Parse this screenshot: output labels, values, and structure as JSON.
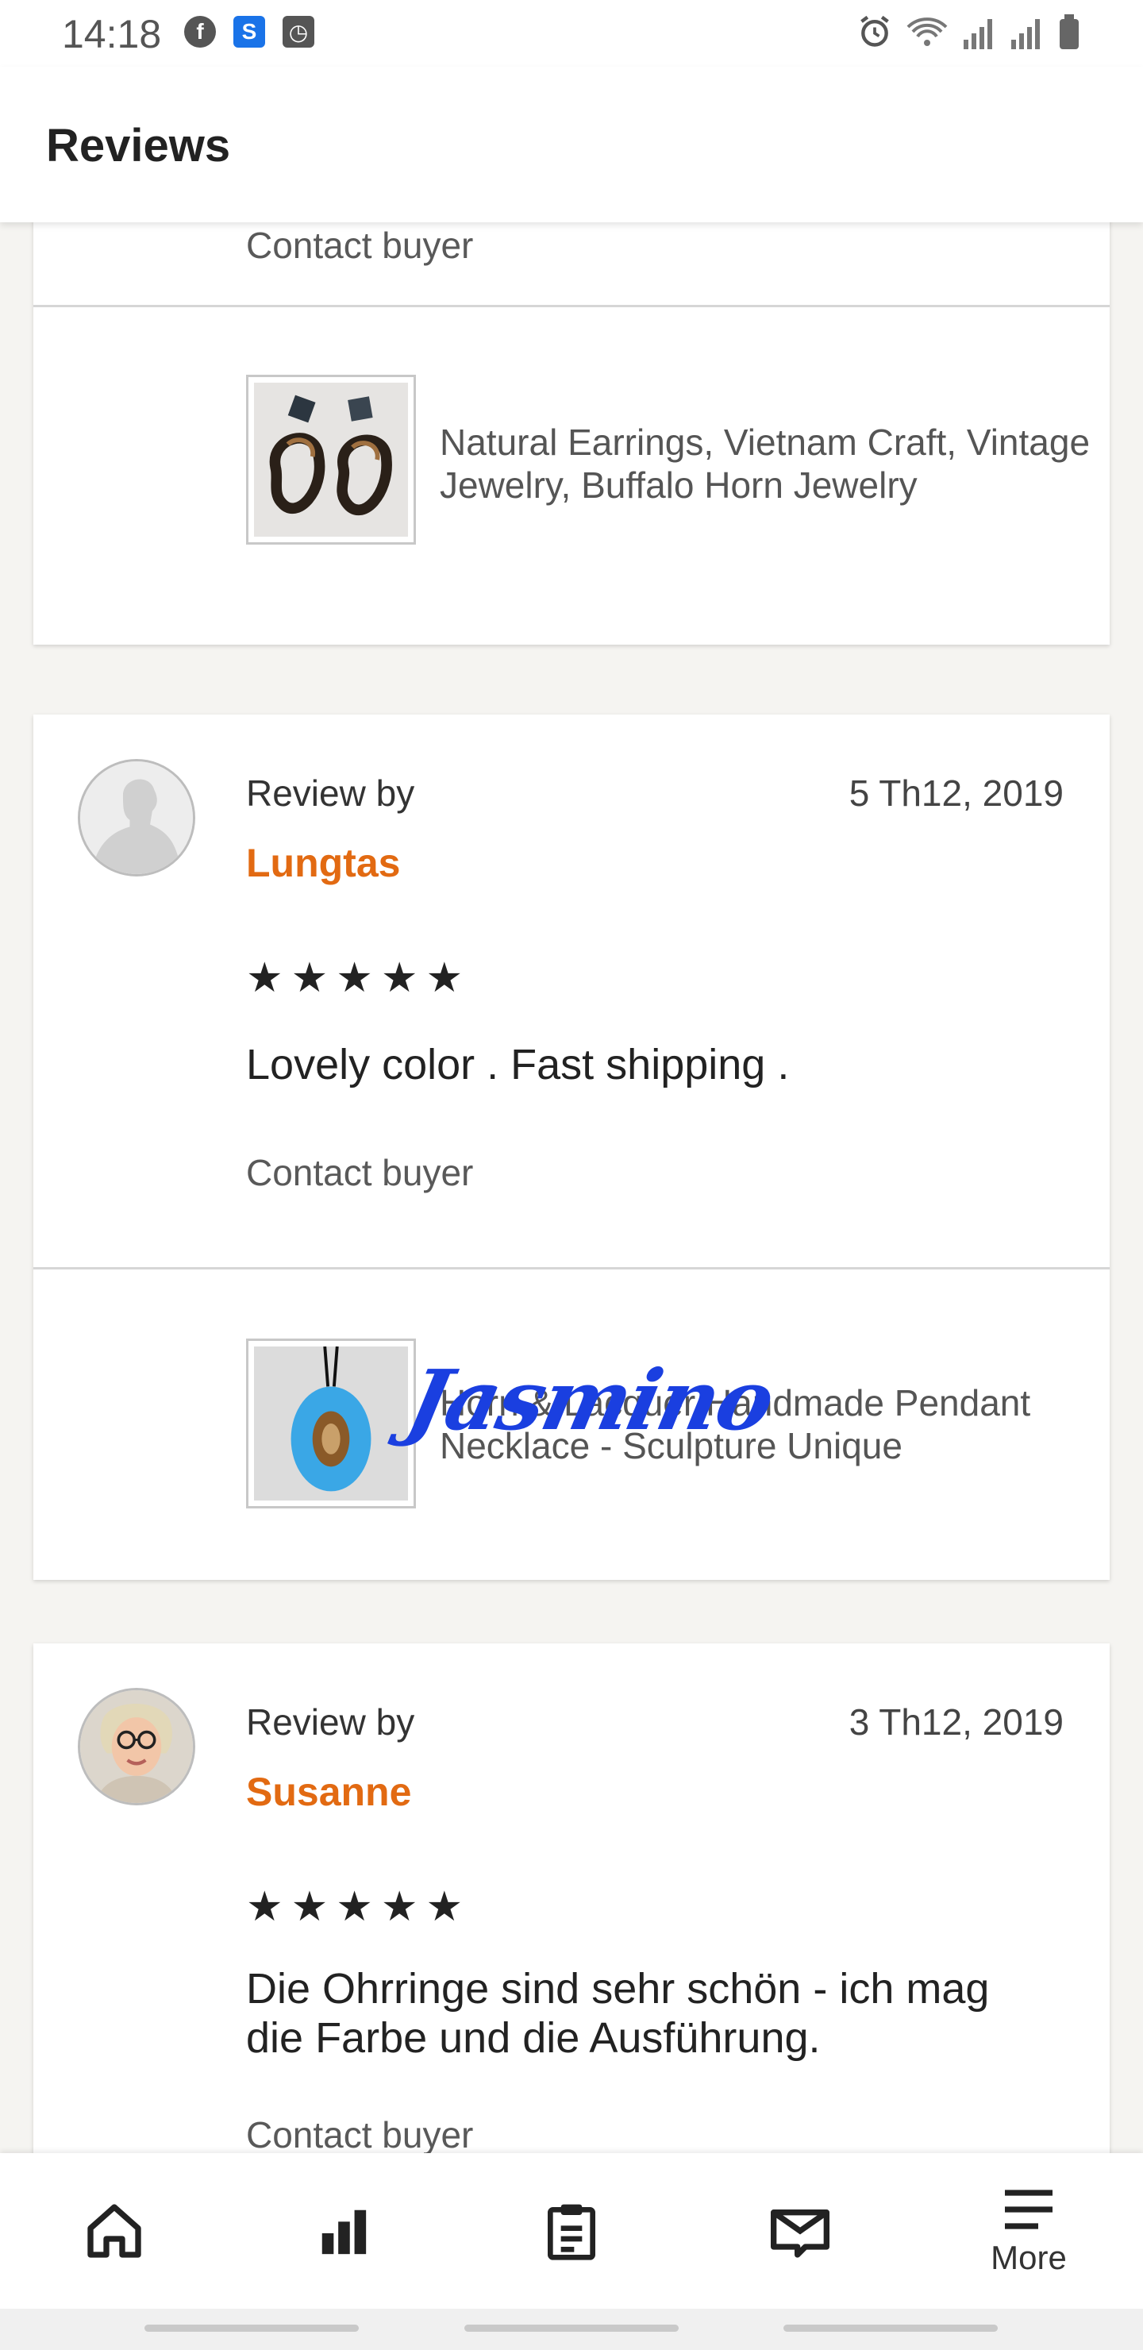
{
  "status_bar": {
    "time": "14:18",
    "left_icons": [
      "facebook-icon",
      "s-app-icon",
      "calendar-app-icon"
    ],
    "right_icons": [
      "alarm-icon",
      "wifi-icon",
      "signal-icon",
      "signal-icon",
      "battery-icon"
    ]
  },
  "header": {
    "title": "Reviews"
  },
  "reviews_top": {
    "contact_label": "Contact buyer"
  },
  "listing_1": {
    "title": "Natural Earrings, Vietnam Craft, Vintage Jewelry, Buffalo Horn Jewelry"
  },
  "review_1": {
    "review_by": "Review by",
    "reviewer": "Lungtas",
    "date": "5 Th12, 2019",
    "stars": "★★★★★",
    "rating": 5,
    "text": "Lovely color . Fast shipping .",
    "contact_label": "Contact buyer"
  },
  "watermark": "Jasmino",
  "listing_2": {
    "title": "Horn & Lacquer Handmade Pendant Necklace - Sculpture Unique"
  },
  "review_2": {
    "review_by": "Review by",
    "reviewer": "Susanne",
    "date": "3 Th12, 2019",
    "stars": "★★★★★",
    "rating": 5,
    "text": "Die Ohrringe sind sehr schön - ich mag die Farbe und die Ausführung.",
    "contact_label": "Contact buyer"
  },
  "bottom_nav": {
    "items": [
      {
        "icon": "home-icon",
        "label": ""
      },
      {
        "icon": "stats-icon",
        "label": ""
      },
      {
        "icon": "orders-icon",
        "label": ""
      },
      {
        "icon": "messages-icon",
        "label": ""
      },
      {
        "icon": "menu-icon",
        "label": "More"
      }
    ]
  },
  "colors": {
    "reviewer_name": "#e26a12",
    "background": "#f5f4f1",
    "watermark": "#1a3fe0"
  }
}
